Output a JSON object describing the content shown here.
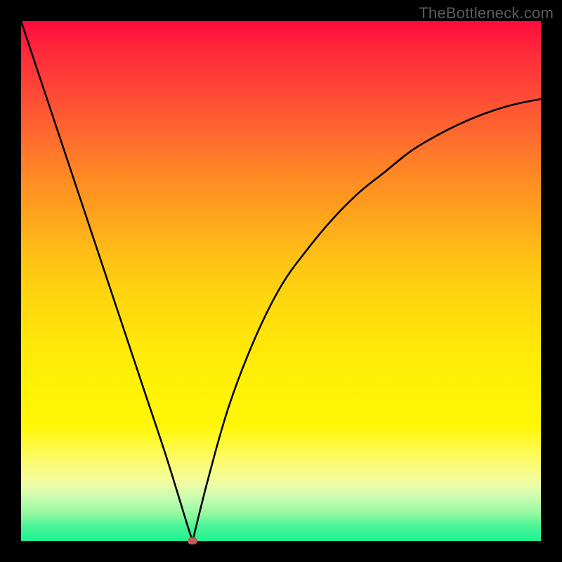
{
  "watermark": "TheBottleneck.com",
  "colors": {
    "background": "#000000",
    "curve_stroke": "#000000",
    "dot_fill": "#c55a5a"
  },
  "chart_data": {
    "type": "line",
    "title": "",
    "xlabel": "",
    "ylabel": "",
    "xlim": [
      0,
      100
    ],
    "ylim": [
      0,
      100
    ],
    "grid": false,
    "legend": false,
    "annotations": [
      {
        "type": "marker",
        "shape": "ellipse",
        "x": 33,
        "y": 0,
        "label": "optimal-point"
      }
    ],
    "series": [
      {
        "name": "bottleneck-curve-left",
        "x": [
          0,
          4,
          8,
          12,
          16,
          20,
          24,
          28,
          32,
          33
        ],
        "y": [
          100,
          88,
          76,
          64,
          52,
          40,
          28,
          16,
          3,
          0
        ]
      },
      {
        "name": "bottleneck-curve-right",
        "x": [
          33,
          36,
          40,
          45,
          50,
          55,
          60,
          65,
          70,
          75,
          80,
          85,
          90,
          95,
          100
        ],
        "y": [
          0,
          12,
          26,
          39,
          49,
          56,
          62,
          67,
          71,
          75,
          78,
          80.5,
          82.5,
          84,
          85
        ]
      }
    ],
    "background_gradient": {
      "direction": "vertical",
      "stops": [
        {
          "pos": 0.0,
          "color": "#ff0a3c"
        },
        {
          "pos": 0.3,
          "color": "#ff8a24"
        },
        {
          "pos": 0.6,
          "color": "#ffe708"
        },
        {
          "pos": 0.85,
          "color": "#f0fca6"
        },
        {
          "pos": 1.0,
          "color": "#1df393"
        }
      ]
    }
  }
}
